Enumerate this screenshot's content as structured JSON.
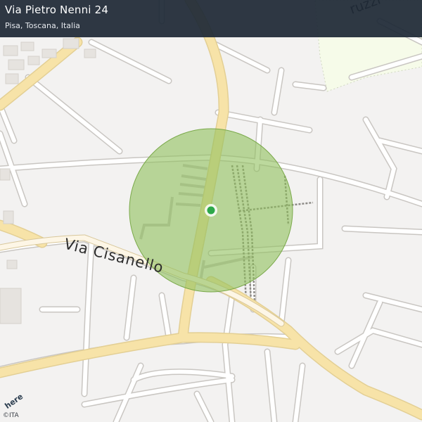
{
  "header": {
    "title": "Via Pietro Nenni 24",
    "subtitle": "Pisa, Toscana, Italia"
  },
  "map": {
    "street_labels": [
      "Via  Cisanello",
      "ruzzi"
    ],
    "colors": {
      "background": "#f3f2f1",
      "road_major": "#f7e3a8",
      "accuracy_circle": "#8fbf5c",
      "location_dot": "#2ea84a",
      "park": "#f6fbe9",
      "header_bg": "#1e2936"
    }
  },
  "footer": {
    "logo_text": "here",
    "copyright": "©ITA"
  }
}
